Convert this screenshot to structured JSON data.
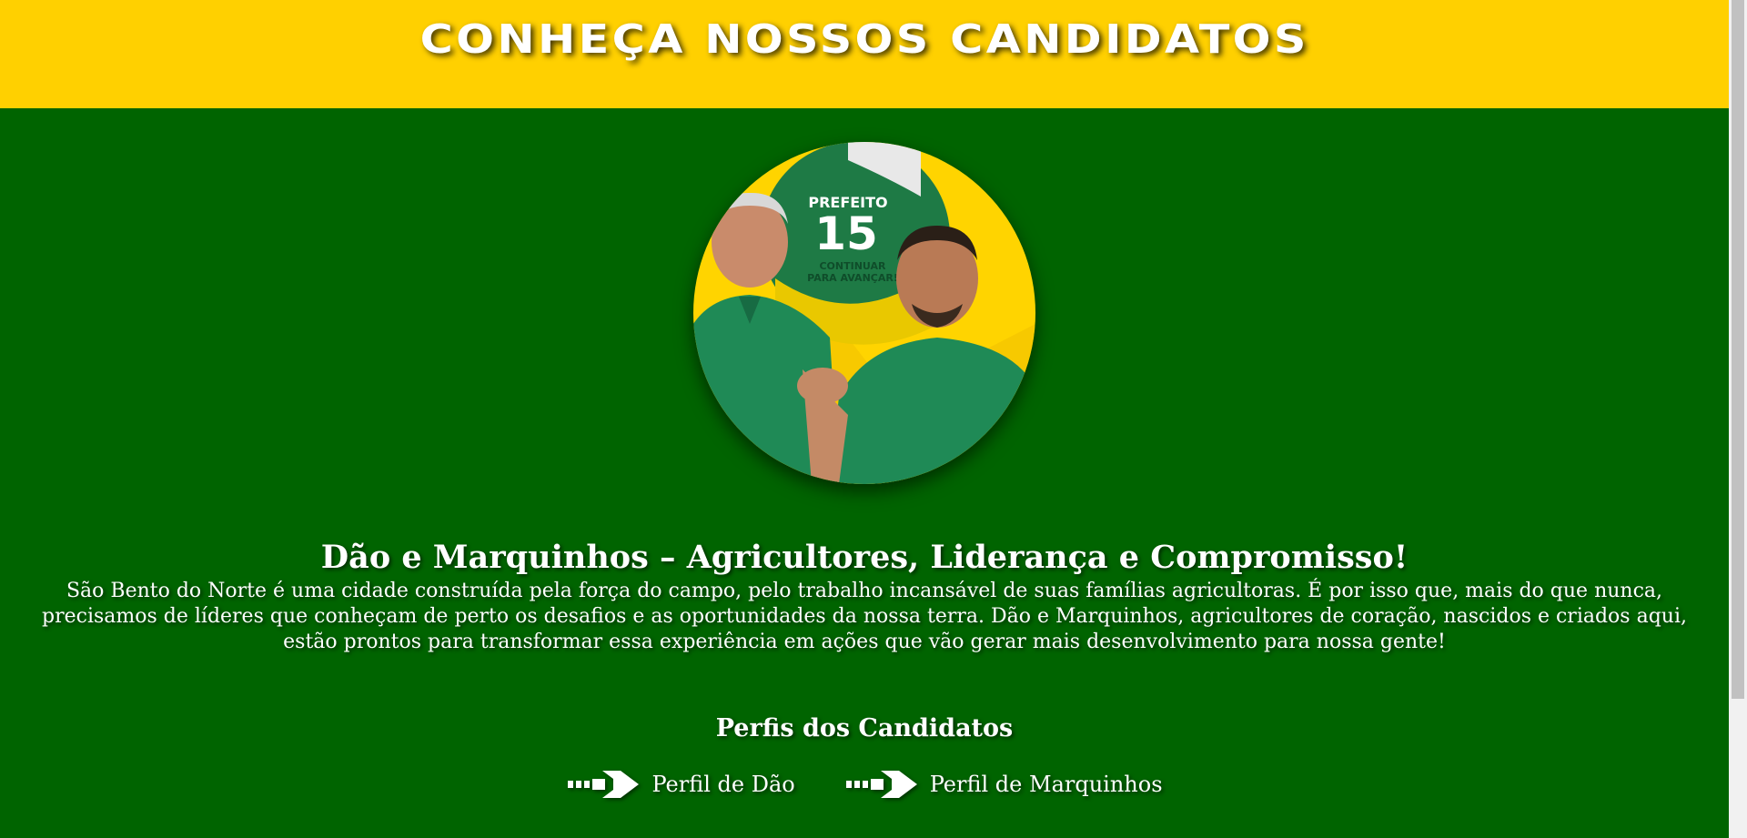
{
  "header": {
    "title": "CONHEÇA NOSSOS CANDIDATOS",
    "background": "#FFD000"
  },
  "hero": {
    "photo_icon": "candidates-photo",
    "badge": {
      "role": "PREFEITO",
      "number": "15",
      "slogan_line1": "CONTINUAR",
      "slogan_line2": "PARA AVANÇAR!"
    }
  },
  "content": {
    "headline": "Dão e Marquinhos – Agricultores, Liderança e Compromisso!",
    "description": "São Bento do Norte é uma cidade construída pela força do campo, pelo trabalho incansável de suas famílias agricultoras. É por isso que, mais do que nunca, precisamos de líderes que conheçam de perto os desafios e as oportunidades da nossa terra. Dão e Marquinhos, agricultores de coração, nascidos e criados aqui, estão prontos para transformar essa experiência em ações que vão gerar mais desenvolvimento para nossa gente!"
  },
  "profiles": {
    "title": "Perfis dos Candidatos",
    "links": [
      {
        "label": "Perfil de Dão",
        "icon": "arrow-right-icon"
      },
      {
        "label": "Perfil de Marquinhos",
        "icon": "arrow-right-icon"
      }
    ]
  },
  "colors": {
    "page_background": "#006400",
    "accent_yellow": "#FFD000",
    "text": "#FFFFFF"
  }
}
